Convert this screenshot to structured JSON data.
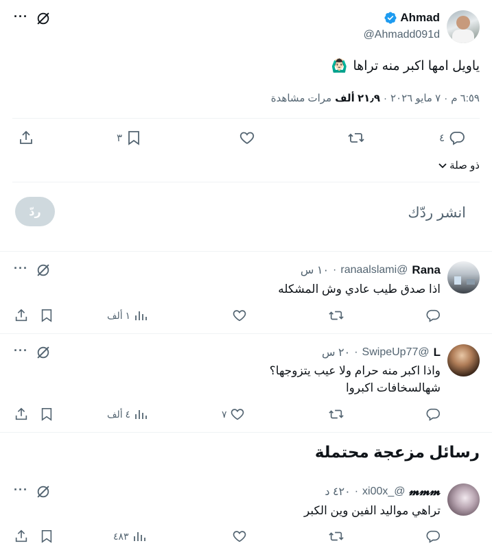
{
  "main_tweet": {
    "display_name": "Ahmad",
    "handle": "@Ahmadd091d",
    "text": "ياويل امها اكبر منه تراها",
    "emoji": "🙆🏻‍♂️",
    "time": "٦:٥٩ م",
    "date": "٧ مايو ٢٠٢٦",
    "views_count": "٢١٫٩ ألف",
    "views_label": "مرات مشاهدة",
    "separator": "·",
    "replies": "٤",
    "retweets": "",
    "likes": "",
    "bookmarks": "٣",
    "relevance_label": "ذو صلة"
  },
  "compose": {
    "placeholder": "انشر ردّك",
    "reply_button": "ردّ"
  },
  "replies": [
    {
      "display_name": "Rana",
      "handle": "@ranaalslami",
      "time": "١٠ س",
      "lines": [
        "اذا صدق طيب عادي وش المشكله"
      ],
      "views": "١ ألف",
      "likes": "",
      "retweets": "",
      "replies": ""
    },
    {
      "display_name": "L",
      "handle": "@SwipeUp77",
      "time": "٢٠ س",
      "lines": [
        "واذا اكبر منه حرام ولا عيب يتزوجها؟",
        "شهالسخافات اكبروا"
      ],
      "views": "٤ ألف",
      "likes": "٧",
      "retweets": "",
      "replies": ""
    }
  ],
  "spam_section": {
    "title": "رسائل مزعجة محتملة"
  },
  "spam_reply": {
    "display_name": "𝓶𝓶𝓶",
    "handle": "@_xi00x",
    "time": "٤٢٠ د",
    "lines": [
      "تراهي مواليد الفين وين الكبر"
    ],
    "views": "٤٨٣",
    "likes": "",
    "retweets": "",
    "replies": ""
  },
  "more_label": "···",
  "colors": {
    "verified": "#1d9bf0",
    "muted": "#536471",
    "divider": "#eff3f4",
    "reply_button_bg": "#cfd9de"
  }
}
